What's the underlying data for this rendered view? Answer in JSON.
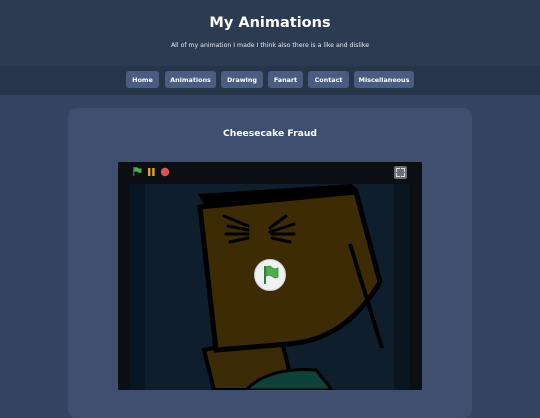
{
  "site": {
    "title": "My Animations",
    "subtitle": "All of my animation I made I think also there is a like and dislike"
  },
  "nav": {
    "items": [
      {
        "label": "Home"
      },
      {
        "label": "Animations"
      },
      {
        "label": "Drawing"
      },
      {
        "label": "Fanart"
      },
      {
        "label": "Contact"
      },
      {
        "label": "Miscellaneous"
      }
    ]
  },
  "project": {
    "title": "Cheesecake Fraud"
  },
  "player": {
    "controls": [
      "green-flag-icon",
      "pause-icon",
      "stop-icon",
      "fullscreen-icon"
    ],
    "overlay": "green-flag-icon"
  },
  "colors": {
    "background": "#344563",
    "header": "#2c3a52",
    "nav_bar": "#27354b",
    "nav_button": "#4a5d80",
    "card": "#3e4f70",
    "flag_green": "#4cae4f",
    "stop_red": "#d9534f",
    "pause_orange": "#f0a020"
  }
}
